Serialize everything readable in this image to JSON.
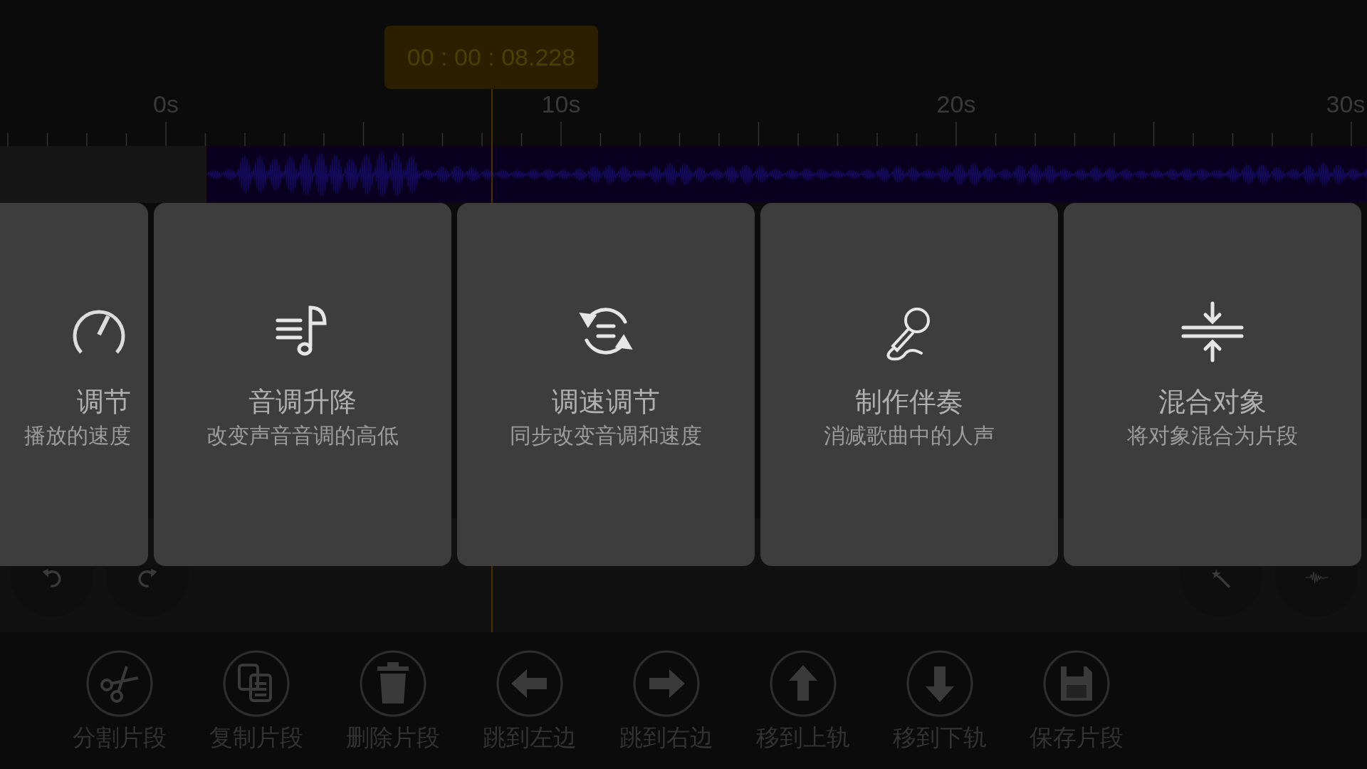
{
  "timecode": "00 : 00 : 08.228",
  "ruler": {
    "labels": [
      "0s",
      "10s",
      "20s",
      "30s"
    ]
  },
  "cards": [
    {
      "kind": "gauge",
      "title": "调节",
      "subtitle": "播放的速度"
    },
    {
      "kind": "pitch",
      "title": "音调升降",
      "subtitle": "改变声音音调的高低"
    },
    {
      "kind": "tempo",
      "title": "调速调节",
      "subtitle": "同步改变音调和速度"
    },
    {
      "kind": "mic",
      "title": "制作伴奏",
      "subtitle": "消减歌曲中的人声"
    },
    {
      "kind": "merge",
      "title": "混合对象",
      "subtitle": "将对象混合为片段"
    }
  ],
  "toolbar": [
    {
      "kind": "scissors",
      "label": "分割片段"
    },
    {
      "kind": "copy",
      "label": "复制片段"
    },
    {
      "kind": "trash",
      "label": "删除片段"
    },
    {
      "kind": "left",
      "label": "跳到左边"
    },
    {
      "kind": "right",
      "label": "跳到右边"
    },
    {
      "kind": "up",
      "label": "移到上轨"
    },
    {
      "kind": "down",
      "label": "移到下轨"
    },
    {
      "kind": "save",
      "label": "保存片段"
    }
  ]
}
